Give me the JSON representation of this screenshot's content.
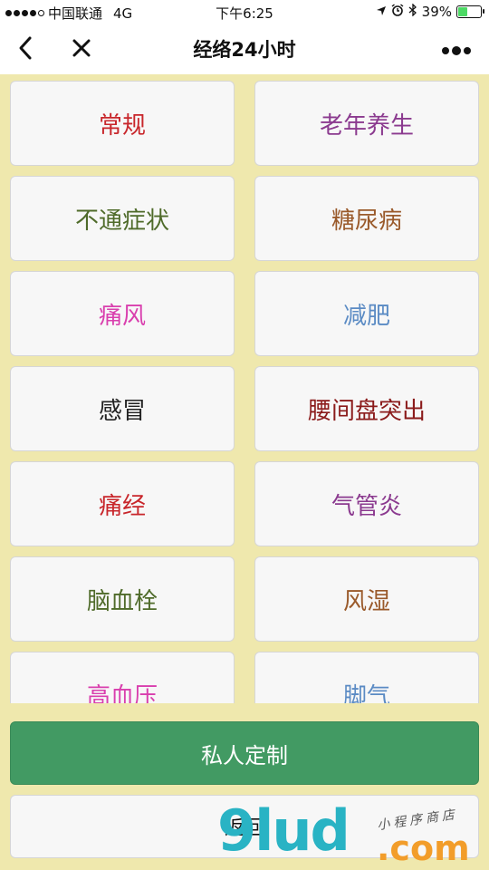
{
  "status_bar": {
    "carrier": "中国联通",
    "network": "4G",
    "time": "下午6:25",
    "battery_percent": "39%",
    "battery_level": 0.39
  },
  "nav": {
    "title": "经络24小时"
  },
  "tiles": [
    {
      "label": "常规",
      "color": "#c8262b"
    },
    {
      "label": "老年养生",
      "color": "#8b3a8f"
    },
    {
      "label": "不通症状",
      "color": "#4f6b2a"
    },
    {
      "label": "糖尿病",
      "color": "#9a5a2b"
    },
    {
      "label": "痛风",
      "color": "#d93fae"
    },
    {
      "label": "减肥",
      "color": "#5b8bc4"
    },
    {
      "label": "感冒",
      "color": "#222222"
    },
    {
      "label": "腰间盘突出",
      "color": "#8b1b1b"
    },
    {
      "label": "痛经",
      "color": "#c8262b"
    },
    {
      "label": "气管炎",
      "color": "#8b3a8f"
    },
    {
      "label": "脑血栓",
      "color": "#4f6b2a"
    },
    {
      "label": "风湿",
      "color": "#9a5a2b"
    },
    {
      "label": "高血压",
      "color": "#d93fae"
    },
    {
      "label": "脚气",
      "color": "#5b8bc4"
    }
  ],
  "buttons": {
    "custom": "私人定制",
    "back": "返回"
  },
  "watermark": {
    "main": "9lud",
    "suffix": ".com",
    "tagline": "小程序商店"
  },
  "colors": {
    "background": "#efe8ad",
    "primary_button": "#429a63"
  }
}
